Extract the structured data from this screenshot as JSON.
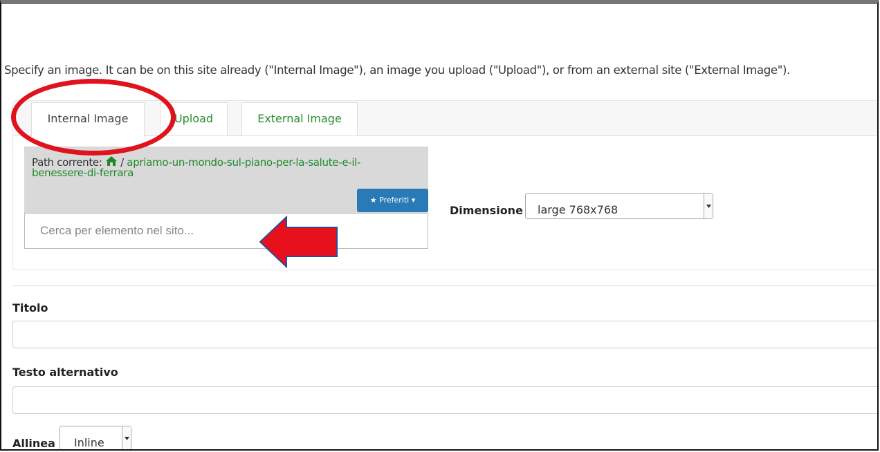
{
  "intro_text": "Specify an image. It can be on this site already (\"Internal Image\"), an image you upload (\"Upload\"), or from an external site (\"External Image\").",
  "tabs": [
    {
      "label": "Internal Image",
      "active": true
    },
    {
      "label": "Upload",
      "active": false
    },
    {
      "label": "External Image",
      "active": false
    }
  ],
  "browser": {
    "path_label": "Path corrente:",
    "path_separator": "/",
    "path_link": "apriamo-un-mondo-sul-piano-per-la-salute-e-il-benessere-di-ferrara",
    "favorites_label": "Preferiti",
    "search_placeholder": "Cerca per elemento nel sito..."
  },
  "dimension": {
    "label": "Dimensione",
    "selected": "large 768x768"
  },
  "fields": {
    "title_label": "Titolo",
    "title_value": "",
    "alt_label": "Testo alternativo",
    "alt_value": ""
  },
  "align": {
    "label": "Allinea",
    "selected": "Inline"
  },
  "colors": {
    "link_green": "#1f8a2a",
    "button_blue": "#2a7ab8",
    "annotation_red": "#e0121d"
  },
  "icons": {
    "home": "home-icon",
    "star": "star-icon",
    "caret": "caret-down-icon"
  }
}
